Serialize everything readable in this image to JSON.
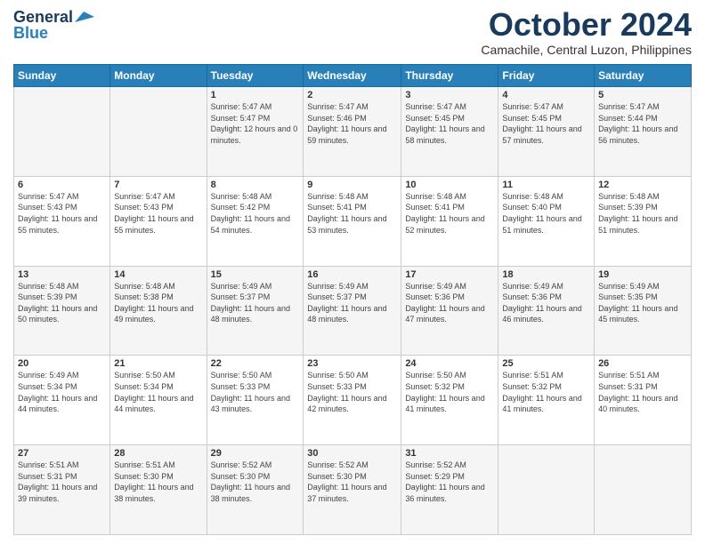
{
  "header": {
    "logo_line1": "General",
    "logo_line2": "Blue",
    "month": "October 2024",
    "location": "Camachile, Central Luzon, Philippines"
  },
  "weekdays": [
    "Sunday",
    "Monday",
    "Tuesday",
    "Wednesday",
    "Thursday",
    "Friday",
    "Saturday"
  ],
  "weeks": [
    [
      {
        "day": "",
        "sunrise": "",
        "sunset": "",
        "daylight": ""
      },
      {
        "day": "",
        "sunrise": "",
        "sunset": "",
        "daylight": ""
      },
      {
        "day": "1",
        "sunrise": "Sunrise: 5:47 AM",
        "sunset": "Sunset: 5:47 PM",
        "daylight": "Daylight: 12 hours and 0 minutes."
      },
      {
        "day": "2",
        "sunrise": "Sunrise: 5:47 AM",
        "sunset": "Sunset: 5:46 PM",
        "daylight": "Daylight: 11 hours and 59 minutes."
      },
      {
        "day": "3",
        "sunrise": "Sunrise: 5:47 AM",
        "sunset": "Sunset: 5:45 PM",
        "daylight": "Daylight: 11 hours and 58 minutes."
      },
      {
        "day": "4",
        "sunrise": "Sunrise: 5:47 AM",
        "sunset": "Sunset: 5:45 PM",
        "daylight": "Daylight: 11 hours and 57 minutes."
      },
      {
        "day": "5",
        "sunrise": "Sunrise: 5:47 AM",
        "sunset": "Sunset: 5:44 PM",
        "daylight": "Daylight: 11 hours and 56 minutes."
      }
    ],
    [
      {
        "day": "6",
        "sunrise": "Sunrise: 5:47 AM",
        "sunset": "Sunset: 5:43 PM",
        "daylight": "Daylight: 11 hours and 55 minutes."
      },
      {
        "day": "7",
        "sunrise": "Sunrise: 5:47 AM",
        "sunset": "Sunset: 5:43 PM",
        "daylight": "Daylight: 11 hours and 55 minutes."
      },
      {
        "day": "8",
        "sunrise": "Sunrise: 5:48 AM",
        "sunset": "Sunset: 5:42 PM",
        "daylight": "Daylight: 11 hours and 54 minutes."
      },
      {
        "day": "9",
        "sunrise": "Sunrise: 5:48 AM",
        "sunset": "Sunset: 5:41 PM",
        "daylight": "Daylight: 11 hours and 53 minutes."
      },
      {
        "day": "10",
        "sunrise": "Sunrise: 5:48 AM",
        "sunset": "Sunset: 5:41 PM",
        "daylight": "Daylight: 11 hours and 52 minutes."
      },
      {
        "day": "11",
        "sunrise": "Sunrise: 5:48 AM",
        "sunset": "Sunset: 5:40 PM",
        "daylight": "Daylight: 11 hours and 51 minutes."
      },
      {
        "day": "12",
        "sunrise": "Sunrise: 5:48 AM",
        "sunset": "Sunset: 5:39 PM",
        "daylight": "Daylight: 11 hours and 51 minutes."
      }
    ],
    [
      {
        "day": "13",
        "sunrise": "Sunrise: 5:48 AM",
        "sunset": "Sunset: 5:39 PM",
        "daylight": "Daylight: 11 hours and 50 minutes."
      },
      {
        "day": "14",
        "sunrise": "Sunrise: 5:48 AM",
        "sunset": "Sunset: 5:38 PM",
        "daylight": "Daylight: 11 hours and 49 minutes."
      },
      {
        "day": "15",
        "sunrise": "Sunrise: 5:49 AM",
        "sunset": "Sunset: 5:37 PM",
        "daylight": "Daylight: 11 hours and 48 minutes."
      },
      {
        "day": "16",
        "sunrise": "Sunrise: 5:49 AM",
        "sunset": "Sunset: 5:37 PM",
        "daylight": "Daylight: 11 hours and 48 minutes."
      },
      {
        "day": "17",
        "sunrise": "Sunrise: 5:49 AM",
        "sunset": "Sunset: 5:36 PM",
        "daylight": "Daylight: 11 hours and 47 minutes."
      },
      {
        "day": "18",
        "sunrise": "Sunrise: 5:49 AM",
        "sunset": "Sunset: 5:36 PM",
        "daylight": "Daylight: 11 hours and 46 minutes."
      },
      {
        "day": "19",
        "sunrise": "Sunrise: 5:49 AM",
        "sunset": "Sunset: 5:35 PM",
        "daylight": "Daylight: 11 hours and 45 minutes."
      }
    ],
    [
      {
        "day": "20",
        "sunrise": "Sunrise: 5:49 AM",
        "sunset": "Sunset: 5:34 PM",
        "daylight": "Daylight: 11 hours and 44 minutes."
      },
      {
        "day": "21",
        "sunrise": "Sunrise: 5:50 AM",
        "sunset": "Sunset: 5:34 PM",
        "daylight": "Daylight: 11 hours and 44 minutes."
      },
      {
        "day": "22",
        "sunrise": "Sunrise: 5:50 AM",
        "sunset": "Sunset: 5:33 PM",
        "daylight": "Daylight: 11 hours and 43 minutes."
      },
      {
        "day": "23",
        "sunrise": "Sunrise: 5:50 AM",
        "sunset": "Sunset: 5:33 PM",
        "daylight": "Daylight: 11 hours and 42 minutes."
      },
      {
        "day": "24",
        "sunrise": "Sunrise: 5:50 AM",
        "sunset": "Sunset: 5:32 PM",
        "daylight": "Daylight: 11 hours and 41 minutes."
      },
      {
        "day": "25",
        "sunrise": "Sunrise: 5:51 AM",
        "sunset": "Sunset: 5:32 PM",
        "daylight": "Daylight: 11 hours and 41 minutes."
      },
      {
        "day": "26",
        "sunrise": "Sunrise: 5:51 AM",
        "sunset": "Sunset: 5:31 PM",
        "daylight": "Daylight: 11 hours and 40 minutes."
      }
    ],
    [
      {
        "day": "27",
        "sunrise": "Sunrise: 5:51 AM",
        "sunset": "Sunset: 5:31 PM",
        "daylight": "Daylight: 11 hours and 39 minutes."
      },
      {
        "day": "28",
        "sunrise": "Sunrise: 5:51 AM",
        "sunset": "Sunset: 5:30 PM",
        "daylight": "Daylight: 11 hours and 38 minutes."
      },
      {
        "day": "29",
        "sunrise": "Sunrise: 5:52 AM",
        "sunset": "Sunset: 5:30 PM",
        "daylight": "Daylight: 11 hours and 38 minutes."
      },
      {
        "day": "30",
        "sunrise": "Sunrise: 5:52 AM",
        "sunset": "Sunset: 5:30 PM",
        "daylight": "Daylight: 11 hours and 37 minutes."
      },
      {
        "day": "31",
        "sunrise": "Sunrise: 5:52 AM",
        "sunset": "Sunset: 5:29 PM",
        "daylight": "Daylight: 11 hours and 36 minutes."
      },
      {
        "day": "",
        "sunrise": "",
        "sunset": "",
        "daylight": ""
      },
      {
        "day": "",
        "sunrise": "",
        "sunset": "",
        "daylight": ""
      }
    ]
  ]
}
